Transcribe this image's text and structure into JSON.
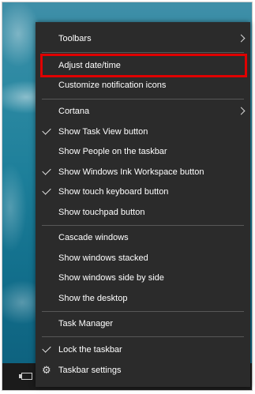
{
  "menu": {
    "toolbars": "Toolbars",
    "adjust_datetime": "Adjust date/time",
    "customize_notifications": "Customize notification icons",
    "cortana": "Cortana",
    "show_task_view": "Show Task View button",
    "show_people": "Show People on the taskbar",
    "show_ink_workspace": "Show Windows Ink Workspace button",
    "show_touch_keyboard": "Show touch keyboard button",
    "show_touchpad": "Show touchpad button",
    "cascade_windows": "Cascade windows",
    "show_stacked": "Show windows stacked",
    "show_side_by_side": "Show windows side by side",
    "show_desktop": "Show the desktop",
    "task_manager": "Task Manager",
    "lock_taskbar": "Lock the taskbar",
    "taskbar_settings": "Taskbar settings"
  },
  "colors": {
    "menu_background": "#2b2b2b",
    "highlight_border": "#e00000"
  },
  "icons": {
    "submenu": "chevron-right-icon",
    "checked": "checkmark-icon",
    "settings": "gear-icon",
    "tray": "tray-icon"
  }
}
